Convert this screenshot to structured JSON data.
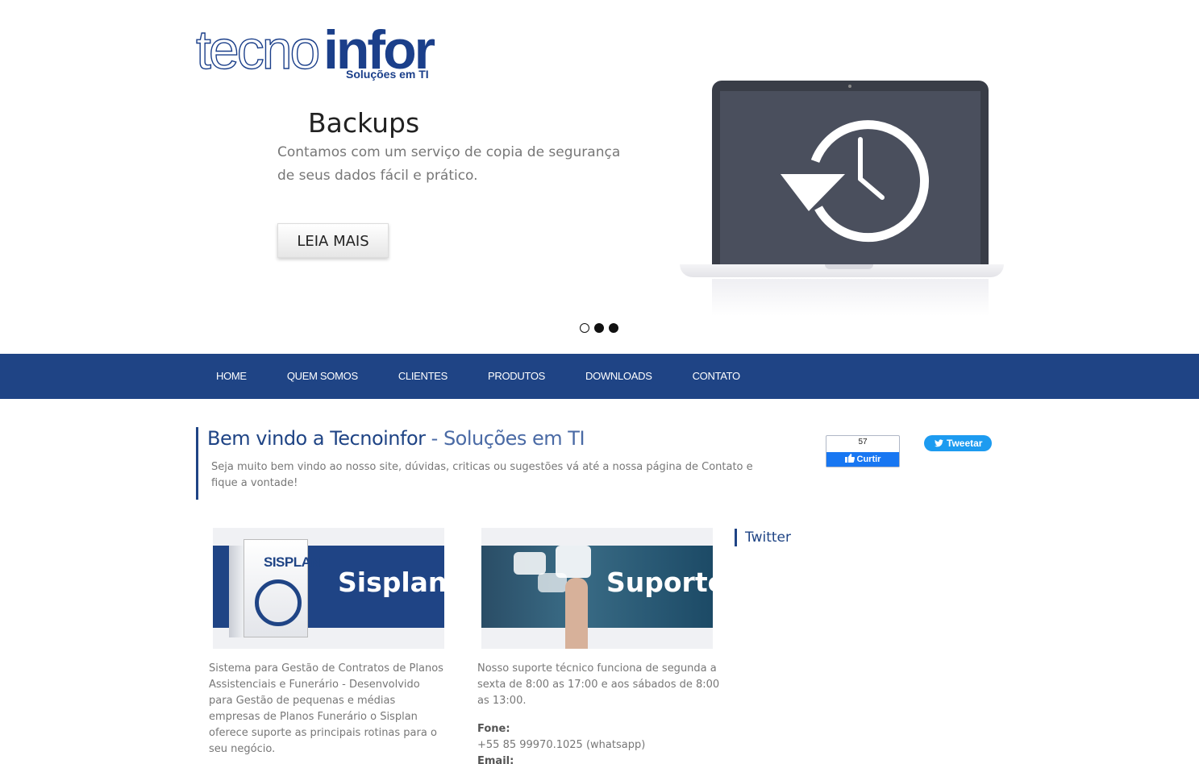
{
  "logo": {
    "part1": "tecno",
    "part2": "infor",
    "tagline": "Soluções em TI"
  },
  "slider": {
    "title": "Backups",
    "text": "Contamos com um serviço de copia de segurança de seus dados fácil e prático.",
    "button": "LEIA MAIS",
    "dots_count": 3,
    "active_dot": 0
  },
  "nav": {
    "items": [
      "HOME",
      "QUEM SOMOS",
      "CLIENTES",
      "PRODUTOS",
      "DOWNLOADS",
      "CONTATO"
    ]
  },
  "welcome": {
    "title": "Bem vindo a Tecnoinfor",
    "subtitle": " - Soluções em TI",
    "text": "Seja muito bem vindo ao nosso site, dúvidas, criticas ou sugestões vá até a nossa página de Contato e fique a vontade!"
  },
  "social": {
    "fb_count": "57",
    "fb_label": "Curtir",
    "tw_label": "Tweetar"
  },
  "cards": [
    {
      "label": "Sisplan",
      "box_brand": "SISPLAN",
      "text": "Sistema para Gestão de Contratos de Planos Assistenciais e Funerário - Desenvolvido para Gestão de pequenas e médias empresas de Planos Funerário o Sisplan oferece suporte as principais rotinas para o seu negócio."
    },
    {
      "label": "Suporte",
      "text": "Nosso suporte técnico funciona de segunda a sexta de 8:00 as 17:00 e aos sábados de 8:00 as 13:00.",
      "phone_label": "Fone:",
      "phone": "+55 85 99970.1025 (whatsapp)",
      "email_label": "Email:"
    }
  ],
  "sidebar": {
    "twitter_title": "Twitter"
  },
  "colors": {
    "brand": "#1f4485",
    "text": "#777777",
    "twitter": "#1d9bf0",
    "facebook": "#1877f2"
  },
  "icons": {
    "laptop": "history-clock-icon",
    "twitter": "twitter-bird-icon",
    "facebook": "thumbs-up-icon"
  }
}
